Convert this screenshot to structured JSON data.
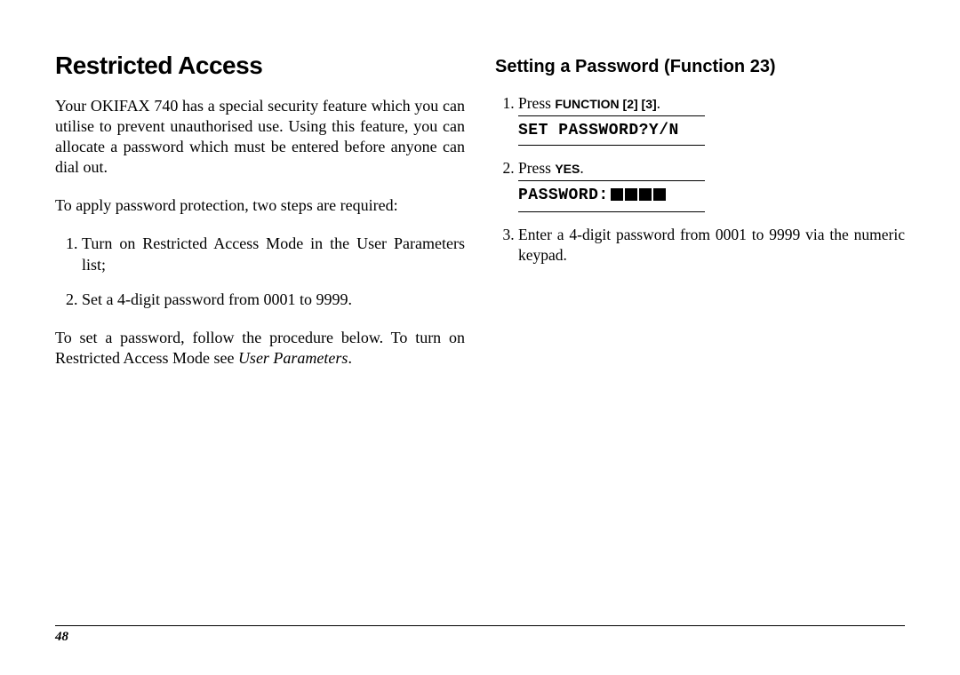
{
  "left": {
    "title": "Restricted Access",
    "intro": "Your OKIFAX 740 has a special security feature which you can utilise to prevent unauthorised use. Using this feature, you can allocate a password which must be entered before anyone can dial out.",
    "steps_lead": "To apply password protection, two steps are required:",
    "steps": [
      "Turn on Restricted Access Mode in the User Parameters list;",
      "Set a 4-digit password from 0001 to 9999."
    ],
    "outro_pre": "To set a password, follow the procedure below. To turn on Restricted Access Mode see ",
    "outro_em": "User Parameters",
    "outro_post": "."
  },
  "right": {
    "heading": "Setting a Password (Function 23)",
    "step1_pre": "Press ",
    "step1_key": "FUNCTION [2] [3]",
    "step1_post": ".",
    "display1": "SET PASSWORD?Y/N",
    "step2_pre": "Press ",
    "step2_key": "YES",
    "step2_post": ".",
    "display2_label": "PASSWORD:",
    "step3": "Enter a 4-digit password from 0001 to 9999 via the numeric keypad."
  },
  "page_number": "48"
}
